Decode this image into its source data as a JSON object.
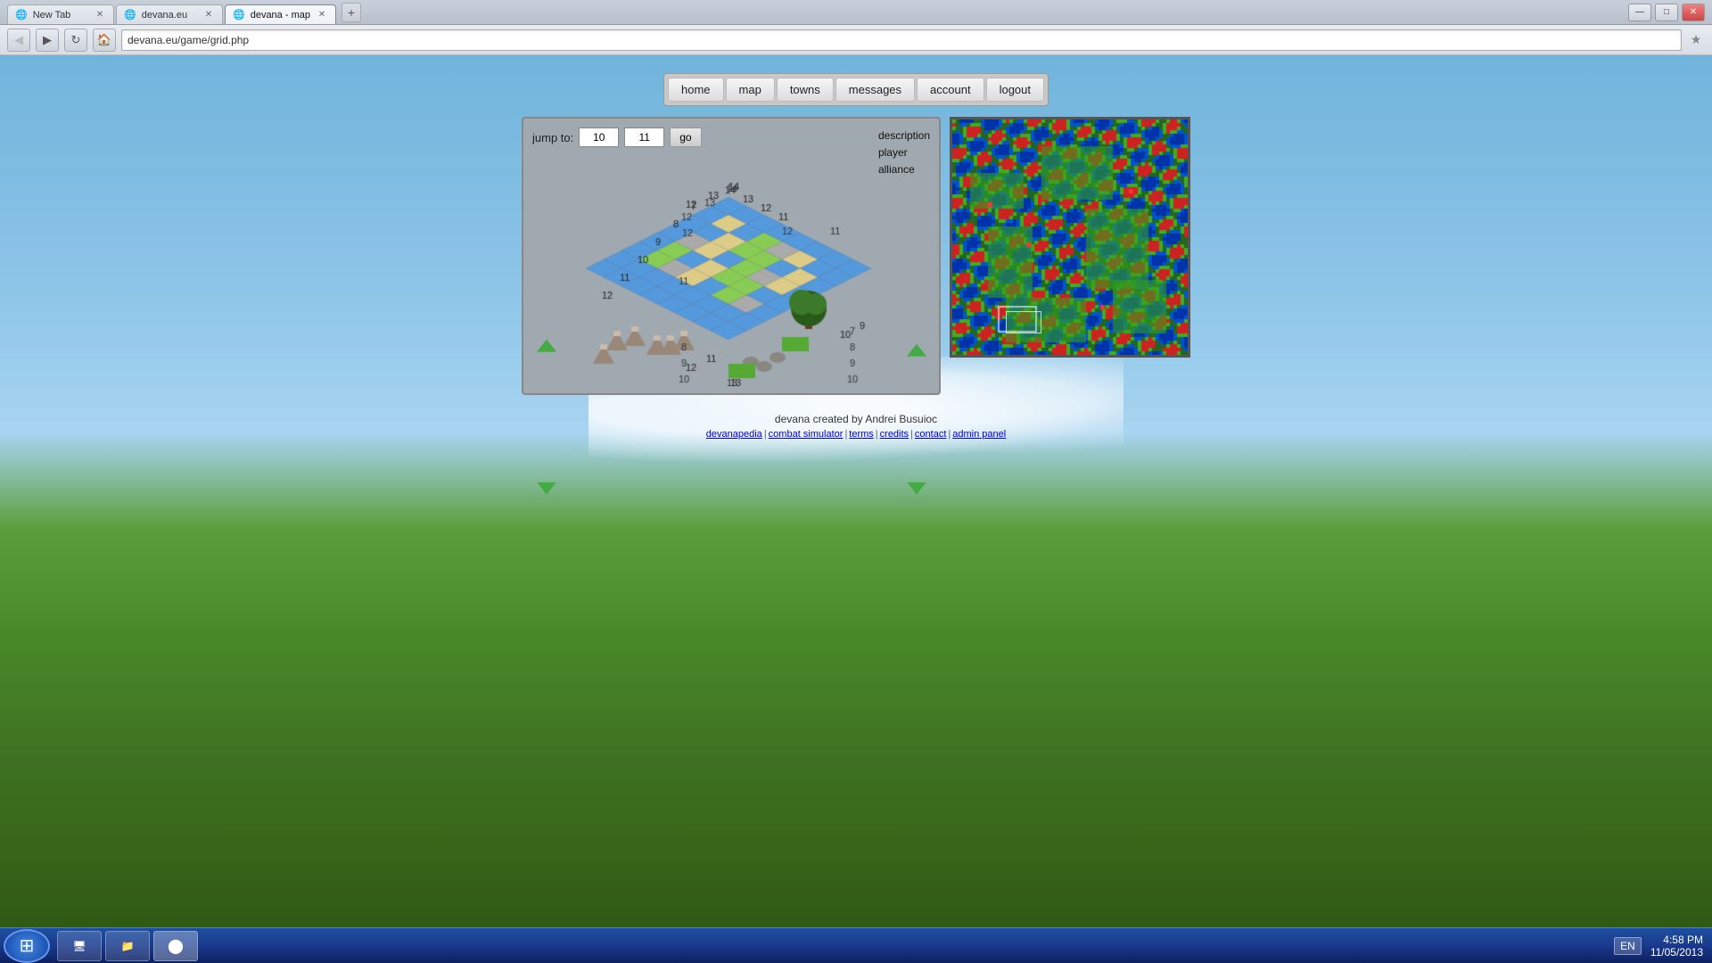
{
  "browser": {
    "tabs": [
      {
        "label": "New Tab",
        "active": false,
        "id": "new-tab"
      },
      {
        "label": "devana.eu",
        "active": false,
        "id": "devana-home"
      },
      {
        "label": "devana - map",
        "active": true,
        "id": "devana-map"
      }
    ],
    "address": "devana.eu/game/grid.php",
    "title": "devana - map"
  },
  "nav": {
    "items": [
      {
        "label": "home",
        "id": "home"
      },
      {
        "label": "map",
        "id": "map"
      },
      {
        "label": "towns",
        "id": "towns"
      },
      {
        "label": "messages",
        "id": "messages"
      },
      {
        "label": "account",
        "id": "account"
      },
      {
        "label": "logout",
        "id": "logout"
      }
    ]
  },
  "game": {
    "jump_to_label": "jump to:",
    "jump_x": "10",
    "jump_y": "11",
    "go_label": "go",
    "info_description": "description",
    "info_player": "player",
    "info_alliance": "alliance",
    "coords": {
      "top": "14",
      "top_left": "13",
      "left_top": "12",
      "row7": "7",
      "row8a": "8",
      "row8b": "8",
      "row9a": "9",
      "row9b": "9",
      "row10a": "10",
      "row10b": "10",
      "row11": "11",
      "row12": "12",
      "row13": "13",
      "col_right": "11",
      "col_right2": "12"
    }
  },
  "footer": {
    "credit": "devana created by Andrei Busuioc",
    "links": [
      {
        "label": "devanapedia",
        "id": "devanapedia"
      },
      {
        "label": "combat simulator",
        "id": "combat-sim"
      },
      {
        "label": "terms",
        "id": "terms"
      },
      {
        "label": "credits",
        "id": "credits"
      },
      {
        "label": "contact",
        "id": "contact"
      },
      {
        "label": "admin panel",
        "id": "admin-panel"
      }
    ]
  },
  "taskbar": {
    "time": "4:58 PM",
    "date": "11/05/2013",
    "lang": "EN"
  }
}
